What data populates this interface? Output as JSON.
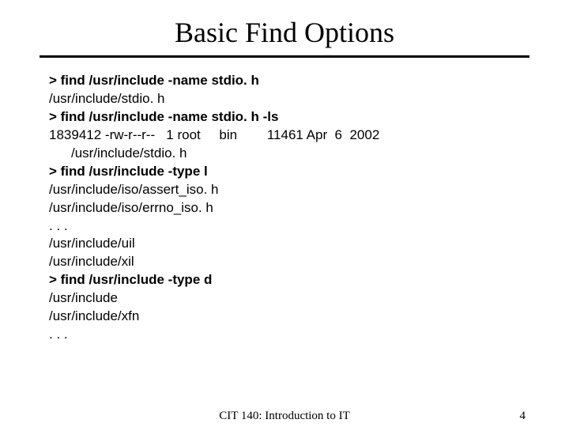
{
  "title": "Basic Find Options",
  "lines": [
    {
      "text": "> find /usr/include -name stdio. h",
      "bold": true
    },
    {
      "text": "/usr/include/stdio. h",
      "bold": false
    },
    {
      "text": "> find /usr/include -name stdio. h -ls",
      "bold": true
    },
    {
      "text": "1839412 -rw-r--r--   1 root     bin        11461 Apr  6  2002",
      "bold": false
    },
    {
      "text": "/usr/include/stdio. h",
      "bold": false,
      "indent": true
    },
    {
      "text": "> find /usr/include -type l",
      "bold": true
    },
    {
      "text": "/usr/include/iso/assert_iso. h",
      "bold": false
    },
    {
      "text": "/usr/include/iso/errno_iso. h",
      "bold": false
    },
    {
      "text": ". . .",
      "bold": false
    },
    {
      "text": "/usr/include/uil",
      "bold": false
    },
    {
      "text": "/usr/include/xil",
      "bold": false
    },
    {
      "text": "> find /usr/include -type d",
      "bold": true
    },
    {
      "text": "/usr/include",
      "bold": false
    },
    {
      "text": "/usr/include/xfn",
      "bold": false
    },
    {
      "text": ". . .",
      "bold": false
    }
  ],
  "footer": {
    "center": "CIT 140: Introduction to IT",
    "page": "4"
  }
}
